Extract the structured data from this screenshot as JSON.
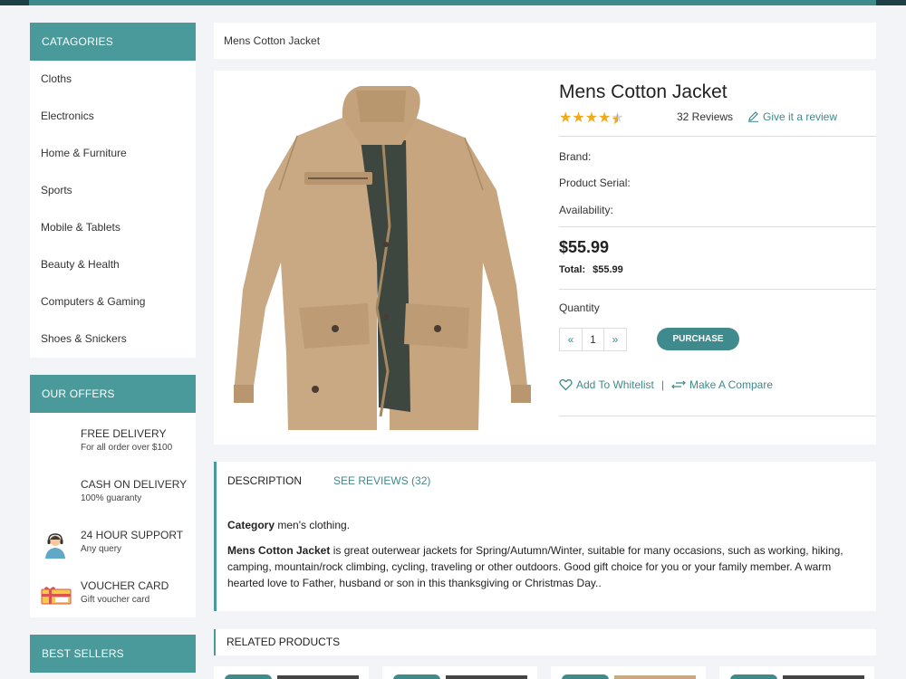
{
  "categories": {
    "heading": "CATAGORIES",
    "items": [
      "Cloths",
      "Electronics",
      "Home & Furniture",
      "Sports",
      "Mobile & Tablets",
      "Beauty & Health",
      "Computers & Gaming",
      "Shoes & Snickers"
    ]
  },
  "offers": {
    "heading": "OUR OFFERS",
    "items": [
      {
        "title": "FREE DELIVERY",
        "subtitle": "For all order over $100",
        "icon": "delivery-icon"
      },
      {
        "title": "CASH ON DELIVERY",
        "subtitle": "100% guaranty",
        "icon": "cash-icon"
      },
      {
        "title": "24 HOUR SUPPORT",
        "subtitle": "Any query",
        "icon": "support-agent-icon"
      },
      {
        "title": "VOUCHER CARD",
        "subtitle": "Gift voucher card",
        "icon": "voucher-icon"
      }
    ]
  },
  "best_sellers": {
    "heading": "BEST SELLERS"
  },
  "breadcrumb": "Mens Cotton Jacket",
  "product": {
    "title": "Mens Cotton Jacket",
    "rating": 4.5,
    "reviews": "32 Reviews",
    "give_review": "Give it a review",
    "brand_label": "Brand:",
    "serial_label": "Product Serial:",
    "availability_label": "Availability:",
    "price": "$55.99",
    "total_label": "Total:",
    "total_value": "$55.99",
    "quantity_label": "Quantity",
    "quantity": "1",
    "decrement": "«",
    "increment": "»",
    "purchase": "PURCHASE",
    "whitelist": "Add To Whitelist",
    "separator": "|",
    "compare": "Make A Compare"
  },
  "description": {
    "tab_active": "DESCRIPTION",
    "tab_reviews": "SEE REVIEWS (32)",
    "category_label": "Category",
    "category_value": "men's clothing.",
    "name_bold": "Mens Cotton Jacket",
    "body": "is great outerwear jackets for Spring/Autumn/Winter, suitable for many occasions, such as working, hiking, camping, mountain/rock climbing, cycling, traveling or other outdoors. Good gift choice for you or your family member. A warm hearted love to Father, husband or son in this thanksgiving or Christmas Day.."
  },
  "related": {
    "heading": "RELATED PRODUCTS"
  },
  "colors": {
    "accent": "#4a9a9b",
    "link": "#3e8a8c",
    "star": "#f0a91a",
    "background": "#f2f4f7"
  }
}
